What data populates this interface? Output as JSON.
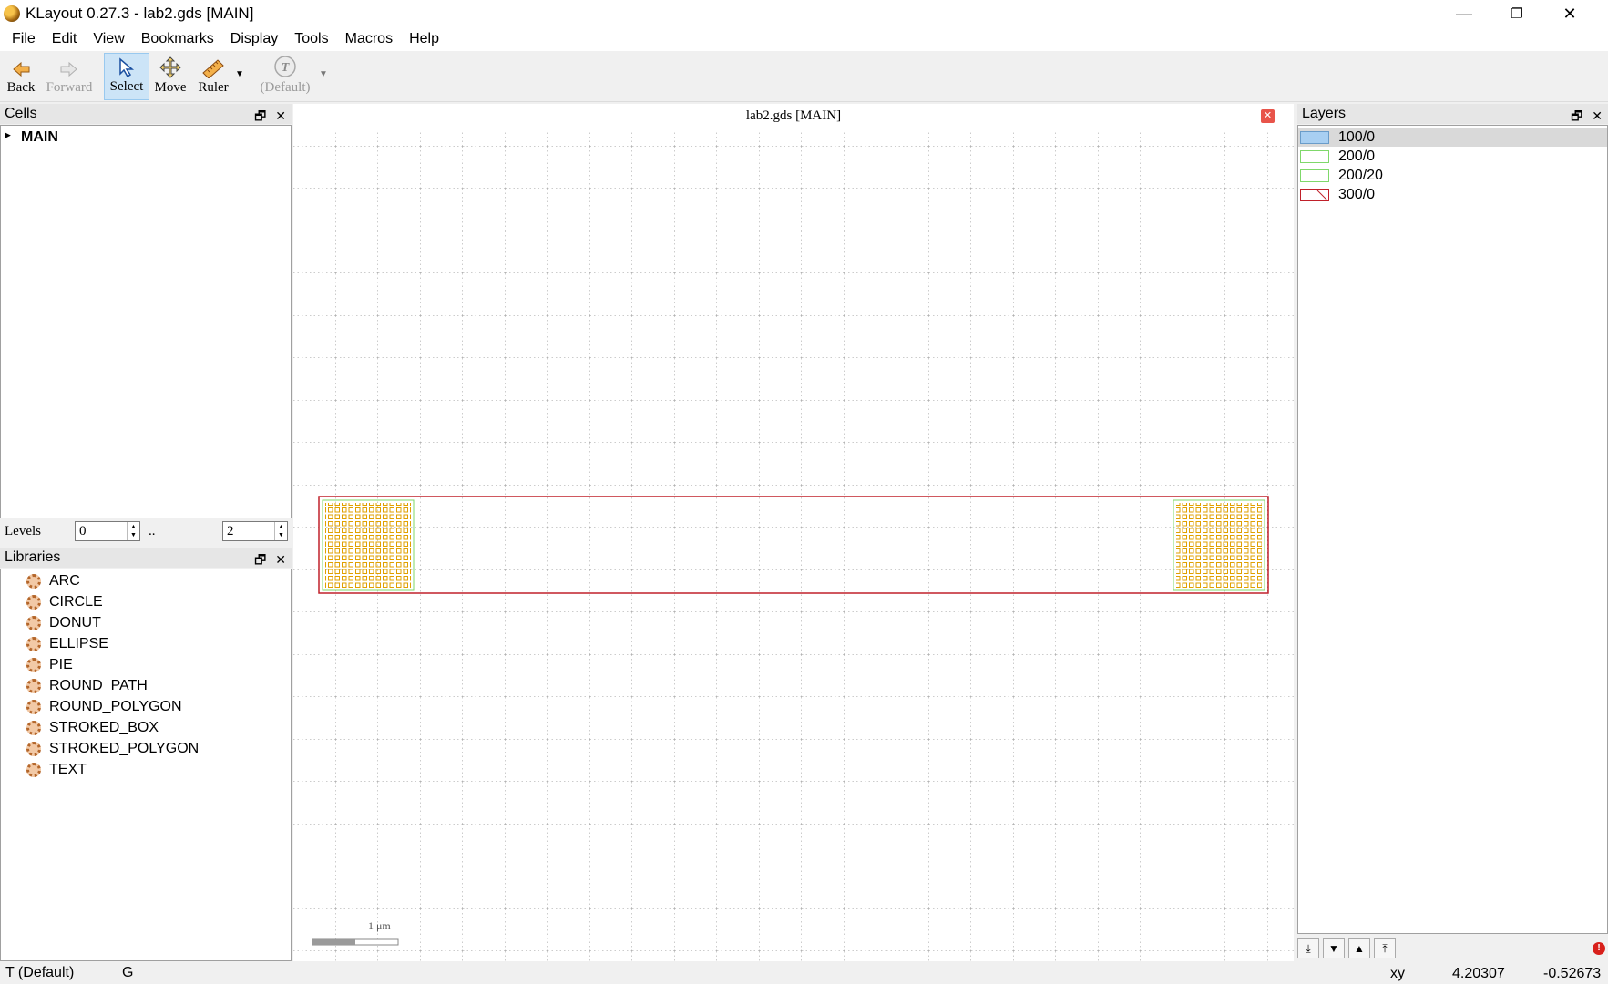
{
  "window": {
    "title": "KLayout 0.27.3 - lab2.gds [MAIN]",
    "minimize": "—",
    "restore": "❐",
    "close": "✕"
  },
  "menu": [
    "File",
    "Edit",
    "View",
    "Bookmarks",
    "Display",
    "Tools",
    "Macros",
    "Help"
  ],
  "toolbar": {
    "back": "Back",
    "forward": "Forward",
    "select": "Select",
    "move": "Move",
    "ruler": "Ruler",
    "text_style": "(Default)"
  },
  "cells": {
    "title": "Cells",
    "items": [
      "MAIN"
    ]
  },
  "levels": {
    "label": "Levels",
    "from": "0",
    "separator": "..",
    "to": "2"
  },
  "libraries": {
    "title": "Libraries",
    "items": [
      "ARC",
      "CIRCLE",
      "DONUT",
      "ELLIPSE",
      "PIE",
      "ROUND_PATH",
      "ROUND_POLYGON",
      "STROKED_BOX",
      "STROKED_POLYGON",
      "TEXT"
    ]
  },
  "canvas": {
    "title": "lab2.gds [MAIN]",
    "scale_label": "1 μm"
  },
  "layers": {
    "title": "Layers",
    "items": [
      {
        "name": "100/0",
        "color": "#9fc8ef",
        "selected": true
      },
      {
        "name": "200/0",
        "color": "#7fd86a",
        "selected": false
      },
      {
        "name": "200/20",
        "color": "#7fd86a",
        "selected": false
      },
      {
        "name": "300/0",
        "color": "#c0202a",
        "selected": false
      }
    ]
  },
  "status": {
    "mode": "T (Default)",
    "grid": "G",
    "coord_label": "xy",
    "x": "4.20307",
    "y": "-0.52673"
  },
  "colors": {
    "boundary": "#c0202a",
    "pad_outline": "#7fd86a",
    "via": "#e0a000"
  }
}
